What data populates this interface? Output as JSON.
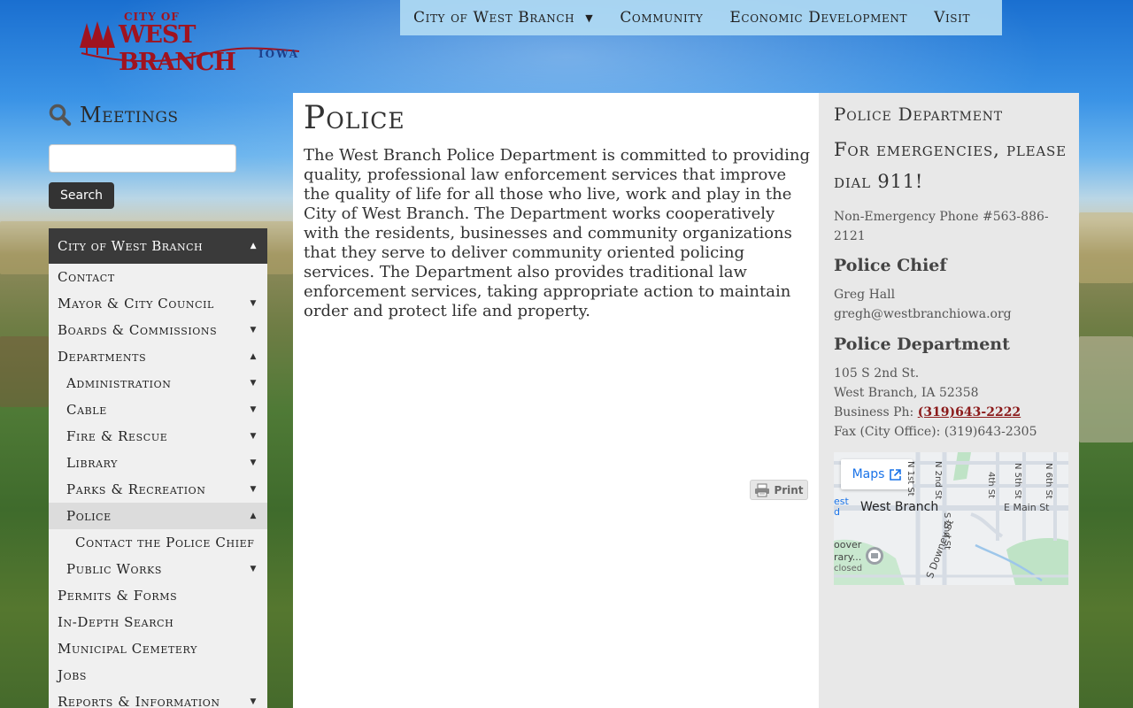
{
  "logo": {
    "city_of": "CITY OF",
    "name": "WEST BRANCH",
    "state": "IOWA"
  },
  "top_nav": {
    "items": [
      {
        "label": "City of West Branch",
        "has_dropdown": true
      },
      {
        "label": "Community",
        "has_dropdown": false
      },
      {
        "label": "Economic Development",
        "has_dropdown": false
      },
      {
        "label": "Visit",
        "has_dropdown": false
      }
    ]
  },
  "meetings": {
    "title": "Meetings"
  },
  "search": {
    "value": "",
    "button_label": "Search"
  },
  "side_nav": {
    "header": "City of West Branch",
    "items": [
      {
        "label": "Contact",
        "level": 0,
        "arrow": ""
      },
      {
        "label": "Mayor & City Council",
        "level": 0,
        "arrow": "▼"
      },
      {
        "label": "Boards & Commissions",
        "level": 0,
        "arrow": "▼"
      },
      {
        "label": "Departments",
        "level": 0,
        "arrow": "▲"
      },
      {
        "label": "Administration",
        "level": 1,
        "arrow": "▼"
      },
      {
        "label": "Cable",
        "level": 1,
        "arrow": "▼"
      },
      {
        "label": "Fire & Rescue",
        "level": 1,
        "arrow": "▼"
      },
      {
        "label": "Library",
        "level": 1,
        "arrow": "▼"
      },
      {
        "label": "Parks & Recreation",
        "level": 1,
        "arrow": "▼"
      },
      {
        "label": "Police",
        "level": 1,
        "arrow": "▲",
        "active": true
      },
      {
        "label": "Contact the Police Chief",
        "level": 2,
        "arrow": ""
      },
      {
        "label": "Public Works",
        "level": 1,
        "arrow": "▼"
      },
      {
        "label": "Permits & Forms",
        "level": 0,
        "arrow": ""
      },
      {
        "label": "In-Depth Search",
        "level": 0,
        "arrow": ""
      },
      {
        "label": "Municipal Cemetery",
        "level": 0,
        "arrow": ""
      },
      {
        "label": "Jobs",
        "level": 0,
        "arrow": ""
      },
      {
        "label": "Reports & Information",
        "level": 0,
        "arrow": "▼"
      }
    ]
  },
  "main": {
    "title": "Police",
    "body": "The West Branch Police Department is committed to providing quality, professional law enforcement services that improve the quality of life for all those who live, work and play in the City of West Branch. The Department works cooperatively with the residents, businesses and community organizations that they serve to deliver community oriented policing services. The Department also provides traditional law enforcement services, taking appropriate action to maintain order and protect life and property.",
    "print_label": "Print"
  },
  "aside": {
    "title": "Police Department",
    "emergency": "For emergencies, please dial 911!",
    "non_emergency": "Non-Emergency Phone #563-886-2121",
    "chief_heading": "Police Chief",
    "chief_name": "Greg Hall",
    "chief_email": "gregh@westbranchiowa.org",
    "dept_heading": "Police Department",
    "address_line1": "105 S 2nd St.",
    "address_line2": "West Branch, IA 52358",
    "business_label": "Business Ph: ",
    "business_phone": "(319)643-2222",
    "fax": "Fax (City Office): (319)643-2305"
  },
  "map": {
    "button_label": "Maps",
    "labels": [
      "N 1st St",
      "N 2nd St",
      "4th St",
      "N 5th St",
      "N 6th St",
      "West Branch",
      "E Main St",
      "S Downey St",
      "S 2nd St",
      "oover",
      "rary...",
      "closed",
      "est",
      "d"
    ]
  },
  "colors": {
    "accent_red": "#a0131f",
    "nav_bg": "#b0daf3",
    "sidenav_header": "#3a3a3a"
  }
}
